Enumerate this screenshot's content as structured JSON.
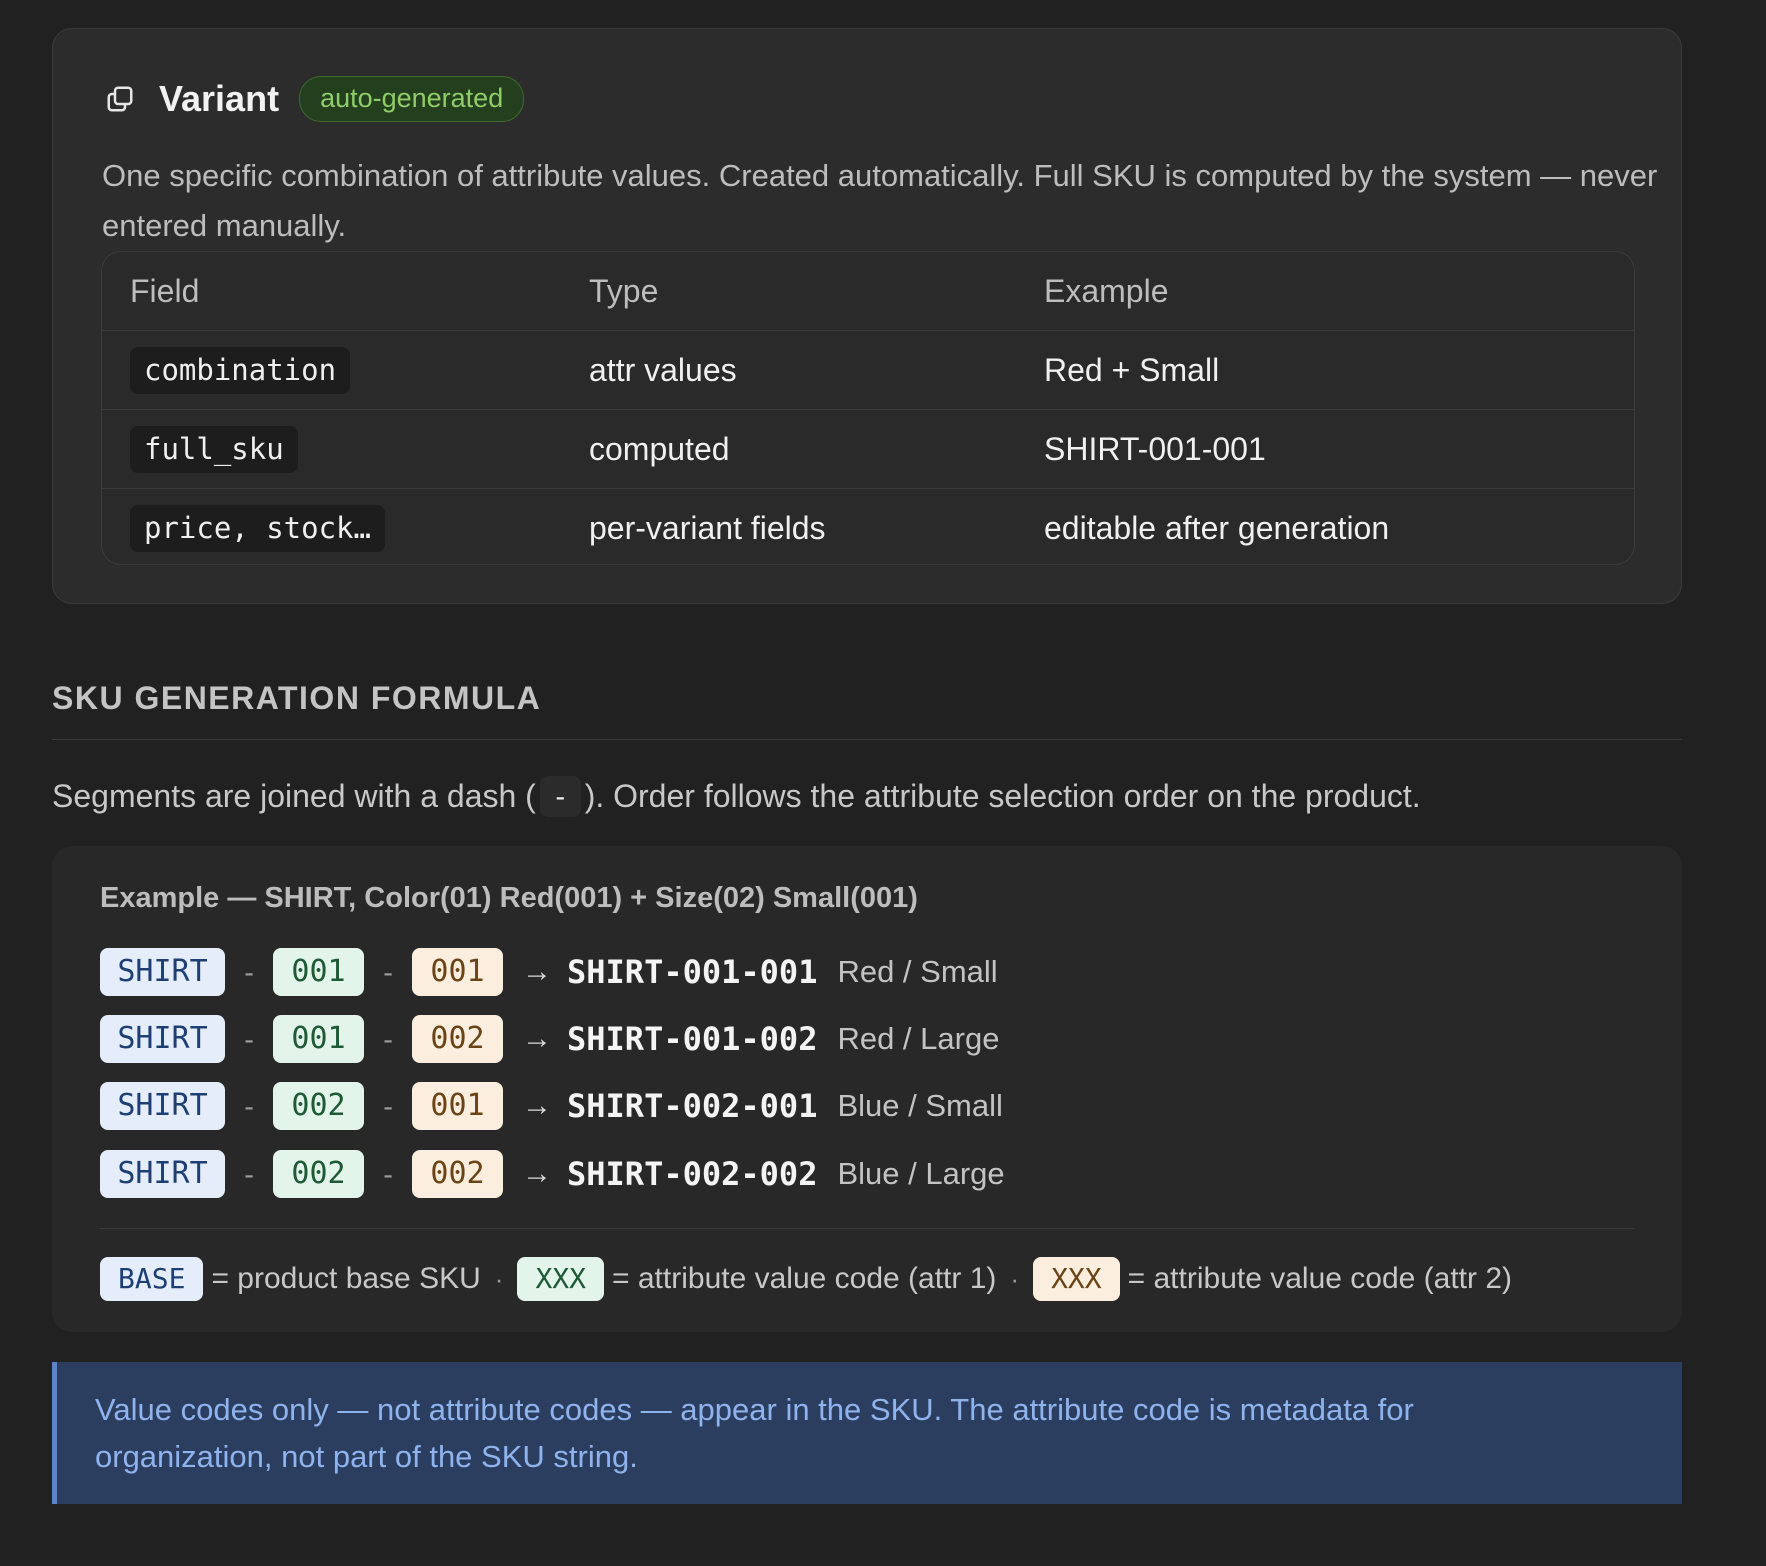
{
  "variant_card": {
    "icon": "copy-icon",
    "title": "Variant",
    "badge": "auto-generated",
    "description": "One specific combination of attribute values. Created automatically. Full SKU is computed by the system — never entered manually.",
    "table": {
      "headers": [
        "Field",
        "Type",
        "Example"
      ],
      "rows": [
        {
          "field": "combination",
          "type": "attr values",
          "example": "Red + Small"
        },
        {
          "field": "full_sku",
          "type": "computed",
          "example": "SHIRT-001-001"
        },
        {
          "field": "price, stock…",
          "type": "per-variant fields",
          "example": "editable after generation"
        }
      ]
    }
  },
  "formula": {
    "heading": "SKU GENERATION FORMULA",
    "desc_before": "Segments are joined with a dash (",
    "dash": "-",
    "desc_after": "). Order follows the attribute selection order on the product.",
    "example": {
      "title": "Example — SHIRT, Color(01) Red(001) + Size(02) Small(001)",
      "separator": "-",
      "arrow": "→",
      "rows": [
        {
          "base": "SHIRT",
          "attr1": "001",
          "attr2": "001",
          "result": "SHIRT-001-001",
          "label": "Red / Small"
        },
        {
          "base": "SHIRT",
          "attr1": "001",
          "attr2": "002",
          "result": "SHIRT-001-002",
          "label": "Red / Large"
        },
        {
          "base": "SHIRT",
          "attr1": "002",
          "attr2": "001",
          "result": "SHIRT-002-001",
          "label": "Blue / Small"
        },
        {
          "base": "SHIRT",
          "attr1": "002",
          "attr2": "002",
          "result": "SHIRT-002-002",
          "label": "Blue / Large"
        }
      ],
      "legend": [
        {
          "chip": "BASE",
          "text": "= product base SKU"
        },
        {
          "chip": "XXX",
          "text": "= attribute value code (attr 1)"
        },
        {
          "chip": "XXX",
          "text": "= attribute value code (attr 2)"
        }
      ],
      "legend_separator": "·"
    }
  },
  "callout": {
    "text": "Value codes only — not attribute codes — appear in the SKU. The attribute code is metadata for organization, not part of the SKU string."
  },
  "colors": {
    "background": "#212121",
    "card": "#2c2c2c",
    "badge_green": "#8fcd6a",
    "base_chip": "#e4edf9",
    "attr1_chip": "#e3f4ea",
    "attr2_chip": "#fbeede",
    "callout_bg": "#2b3e60",
    "callout_text": "#8fb3ec"
  }
}
